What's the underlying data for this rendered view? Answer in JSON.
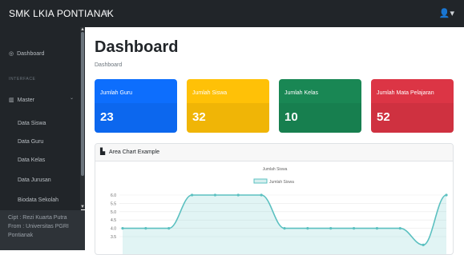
{
  "topbar": {
    "brand": "SMK LKIA PONTIANAK",
    "toggle_icon": "≡",
    "user_icon": "👤▾"
  },
  "sidebar": {
    "dashboard": "Dashboard",
    "heading": "INTERFACE",
    "master": "Master",
    "items": [
      "Data Siswa",
      "Data Guru",
      "Data Kelas",
      "Data Jurusan",
      "Biodata Sekolah"
    ],
    "footer": [
      "Cipt : Rezi Kuarta Putra",
      "From : Universitas PGRI",
      "Pontianak"
    ]
  },
  "main": {
    "title": "Dashboard",
    "breadcrumb": "Dashboard"
  },
  "cards": [
    {
      "label": "Jumlah Guru",
      "value": "23",
      "color": "#0d6efd"
    },
    {
      "label": "Jumlah Siswa",
      "value": "32",
      "color": "#ffc107"
    },
    {
      "label": "Jumlah Kelas",
      "value": "10",
      "color": "#198754"
    },
    {
      "label": "Jumlah Mata Pelajaran",
      "value": "52",
      "color": "#dc3545"
    }
  ],
  "panel": {
    "title": "Area Chart Example"
  },
  "chart_data": {
    "type": "area",
    "title": "Jumlah Siswa",
    "legend": "Jumlah Siswa",
    "color": "#5bc0c0",
    "y_ticks": [
      "6.0",
      "5.5",
      "5.0",
      "4.5",
      "4.0",
      "3.5"
    ],
    "ylim": [
      3.5,
      6.0
    ],
    "values": [
      4.0,
      4.0,
      4.0,
      6.0,
      6.0,
      6.0,
      6.0,
      4.0,
      4.0,
      4.0,
      4.0,
      4.0,
      4.0,
      3.0,
      6.0
    ],
    "legend_placement": "top"
  }
}
